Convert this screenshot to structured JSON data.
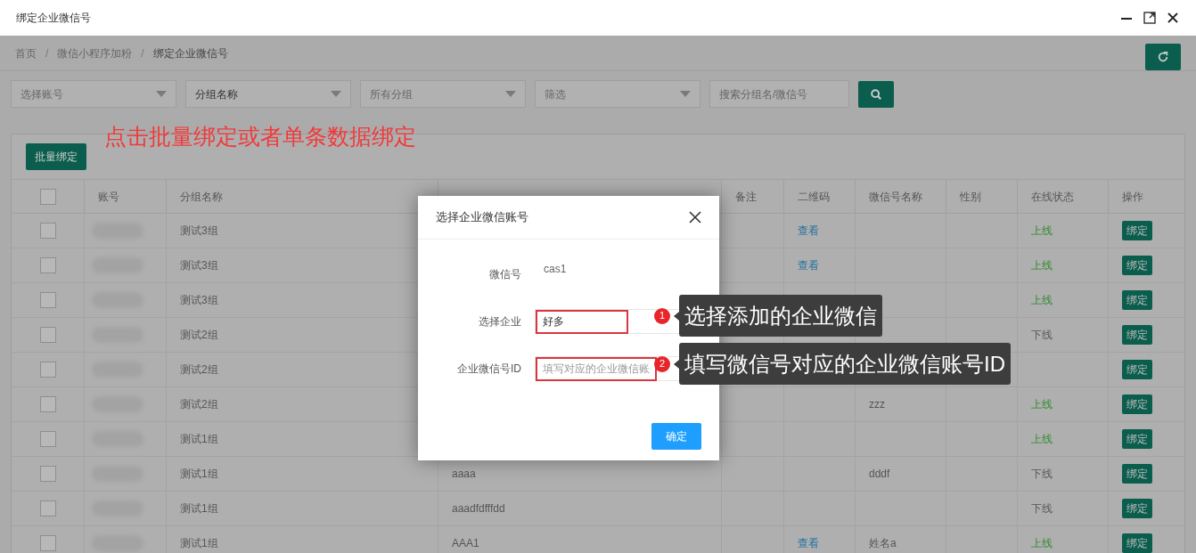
{
  "window": {
    "title": "绑定企业微信号"
  },
  "breadcrumb_separator": "/",
  "breadcrumb": [
    {
      "label": "首页",
      "current": false
    },
    {
      "label": "微信小程序加粉",
      "current": false
    },
    {
      "label": "绑定企业微信号",
      "current": true
    }
  ],
  "filters": [
    {
      "kind": "select",
      "text": "选择账号",
      "placeholder": true
    },
    {
      "kind": "select",
      "text": "分组名称",
      "placeholder": false
    },
    {
      "kind": "select",
      "text": "所有分组",
      "placeholder": true
    },
    {
      "kind": "select",
      "text": "筛选",
      "placeholder": true
    },
    {
      "kind": "search",
      "text": "搜索分组名/微信号",
      "placeholder": true
    }
  ],
  "batch_button": "批量绑定",
  "instruction": "点击批量绑定或者单条数据绑定",
  "table": {
    "header_checked": false,
    "columns": [
      "账号",
      "分组名称",
      null,
      "备注",
      "二维码",
      "微信号名称",
      "性别",
      "在线状态",
      "操作"
    ],
    "rows": [
      {
        "checked": false,
        "group": "测试3组",
        "qr": "查看",
        "status": "上线",
        "online": true,
        "action": "绑定"
      },
      {
        "checked": false,
        "group": "测试3组",
        "qr": "查看",
        "status": "上线",
        "online": true,
        "action": "绑定"
      },
      {
        "checked": false,
        "group": "测试3组",
        "status": "上线",
        "online": true,
        "action": "绑定"
      },
      {
        "checked": false,
        "group": "测试2组",
        "status": "下线",
        "online": false,
        "action": "绑定"
      },
      {
        "checked": false,
        "group": "测试2组",
        "action": "绑定"
      },
      {
        "checked": false,
        "group": "测试2组",
        "name": "zzz",
        "status": "上线",
        "online": true,
        "action": "绑定"
      },
      {
        "checked": false,
        "group": "测试1组",
        "status": "上线",
        "online": true,
        "action": "绑定"
      },
      {
        "checked": false,
        "group": "测试1组",
        "wechat": "aaaa",
        "name": "dddf",
        "status": "下线",
        "online": false,
        "action": "绑定"
      },
      {
        "checked": false,
        "group": "测试1组",
        "wechat": "aaadfdfffdd",
        "status": "下线",
        "online": false,
        "action": "绑定"
      },
      {
        "checked": false,
        "group": "测试1组",
        "wechat": "AAA1",
        "qr": "查看",
        "name": "姓名a",
        "status": "上线",
        "online": true,
        "action": "绑定"
      }
    ]
  },
  "dialog": {
    "title": "选择企业微信账号",
    "fields": [
      {
        "kind": "text",
        "label": "微信号",
        "value": "cas1"
      },
      {
        "kind": "input",
        "label": "选择企业",
        "value": "好多"
      },
      {
        "kind": "input",
        "label": "企业微信号ID",
        "placeholder": "填写对应的企业微信账"
      }
    ],
    "confirm": "确定"
  },
  "callouts": [
    {
      "number": "1",
      "text": "选择添加的企业微信"
    },
    {
      "number": "2",
      "text": "填写微信号对应的企业微信账号ID"
    }
  ]
}
